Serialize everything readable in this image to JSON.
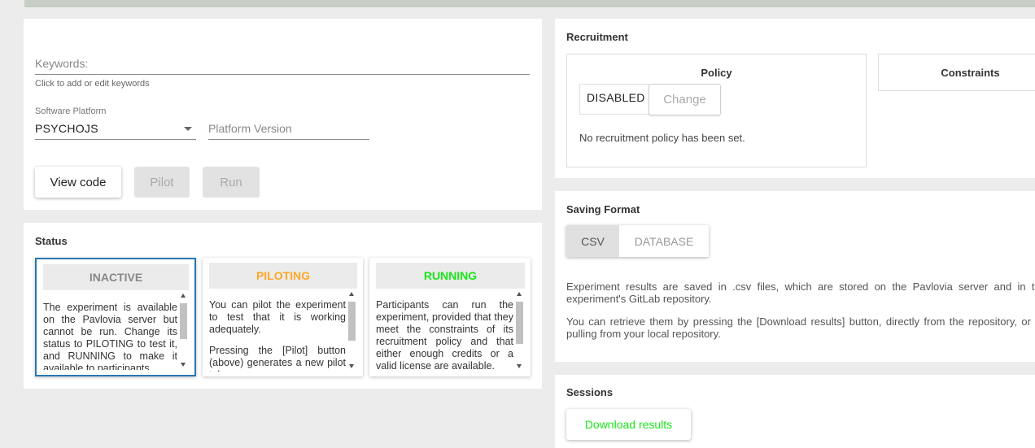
{
  "experiment": {
    "keywords_label": "Keywords:",
    "keywords_help": "Click to add or edit keywords",
    "platform_label": "Software Platform",
    "platform_value": "PSYCHOJS",
    "platform_version_placeholder": "Platform Version",
    "buttons": {
      "view_code": "View code",
      "pilot": "Pilot",
      "run": "Run"
    }
  },
  "status": {
    "title": "Status",
    "states": [
      {
        "label": "INACTIVE",
        "color": "#888888",
        "selected": true,
        "text": "The experiment is available on the Pavlovia server but cannot be run. Change its status to PILOTING to test it, and RUNNING to make it available to participants."
      },
      {
        "label": "PILOTING",
        "color": "#ffa726",
        "selected": false,
        "text": "You can pilot the experiment to test that it is working adequately.",
        "text2": "Pressing the [Pilot] button (above) generates a new pilot token."
      },
      {
        "label": "RUNNING",
        "color": "#19e619",
        "selected": false,
        "text": "Participants can run the experiment, provided that they meet the constraints of its recruitment policy and that either enough credits or a valid license are available."
      }
    ]
  },
  "recruitment": {
    "title": "Recruitment",
    "policy": {
      "title": "Policy",
      "state": "DISABLED",
      "change_button": "Change",
      "note": "No recruitment policy has been set."
    },
    "constraints": {
      "title": "Constraints"
    }
  },
  "saving_format": {
    "title": "Saving Format",
    "options": [
      "CSV",
      "DATABASE"
    ],
    "selected": "CSV",
    "description1": "Experiment results are saved in .csv files, which are stored on the Pavlovia server and in the experiment's GitLab repository.",
    "description2": "You can retrieve them by pressing the [Download results] button, directly from the repository, or by pulling from your local repository."
  },
  "sessions": {
    "title": "Sessions",
    "download_button": "Download results",
    "download_color": "#19e619"
  }
}
